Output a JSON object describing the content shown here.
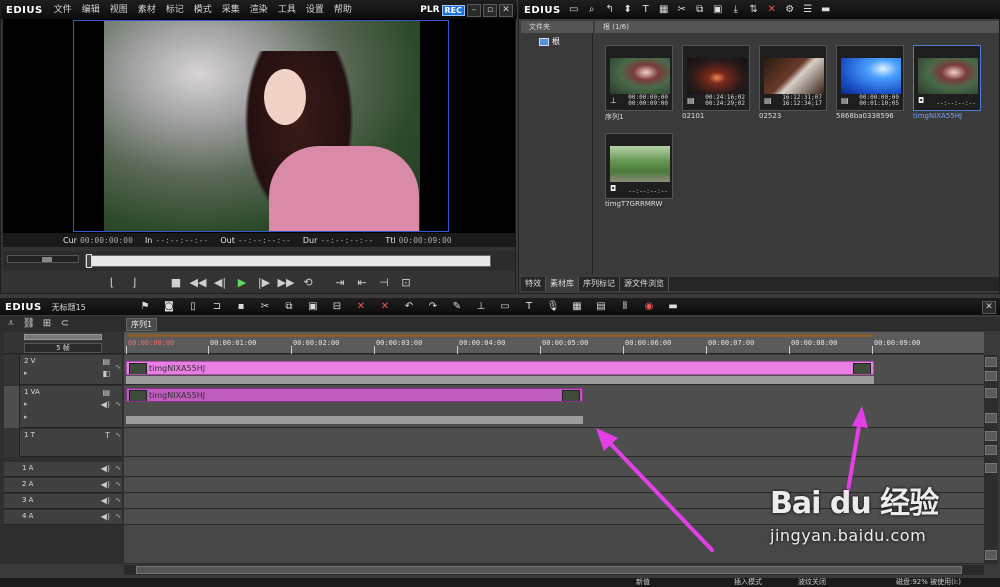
{
  "player": {
    "logo": "EDIUS",
    "menu": [
      "文件",
      "编辑",
      "视图",
      "素材",
      "标记",
      "模式",
      "采集",
      "渲染",
      "工具",
      "设置",
      "帮助"
    ],
    "plr": "PLR",
    "rec": "REC",
    "timecodes": {
      "cur_label": "Cur",
      "cur_value": "00:00:00:00",
      "in_label": "In",
      "in_value": "--:--:--:--",
      "out_label": "Out",
      "out_value": "--:--:--:--",
      "dur_label": "Dur",
      "dur_value": "--:--:--:--",
      "ttl_label": "Ttl",
      "ttl_value": "00:00:09:00"
    }
  },
  "bin": {
    "logo": "EDIUS",
    "folder_header": "文件夹",
    "folder_root": "根",
    "clips_header": "根 (1/6)",
    "clips": [
      {
        "name": "序列1",
        "tc1": "00:00:00;00",
        "tc2": "00:00:09:00",
        "type": "sequence",
        "thumb": "portrait",
        "selected": false
      },
      {
        "name": "02101",
        "tc1": "00:24:16;02",
        "tc2": "00:24:29;02",
        "type": "video",
        "thumb": "dark-red",
        "selected": false
      },
      {
        "name": "02523",
        "tc1": "16:12:31;07",
        "tc2": "16:12:34;17",
        "type": "video",
        "thumb": "hand",
        "selected": false
      },
      {
        "name": "5868ba0338596",
        "tc1": "00:00:00;00",
        "tc2": "00:01:10;05",
        "type": "video",
        "thumb": "blue",
        "selected": false
      },
      {
        "name": "timgNIXA55HJ",
        "tc1": "",
        "tc2": "--:--:--:--",
        "type": "still",
        "thumb": "portrait",
        "selected": true
      },
      {
        "name": "timgT7GRRMRW",
        "tc1": "",
        "tc2": "--:--:--:--",
        "type": "still",
        "thumb": "park",
        "selected": false
      }
    ],
    "tabs": [
      "特效",
      "素材库",
      "序列标记",
      "源文件浏览"
    ]
  },
  "timeline": {
    "logo": "EDIUS",
    "title": "无标题15",
    "sequence_tab": "序列1",
    "zoom_label": "5 帧",
    "ruler": [
      "00:00:00:00",
      "00:00:01:00",
      "00:00:02:00",
      "00:00:03:00",
      "00:00:04:00",
      "00:00:05:00",
      "00:00:06:00",
      "00:00:07:00",
      "00:00:08:00",
      "00:00:09:00"
    ],
    "tracks": [
      {
        "name": "2 V",
        "clip": "timgNIXA55HJ"
      },
      {
        "name": "1 VA",
        "clip": "timgNIXA55HJ"
      },
      {
        "name": "1 T"
      },
      {
        "name": "1 A"
      },
      {
        "name": "2 A"
      },
      {
        "name": "3 A"
      },
      {
        "name": "4 A"
      }
    ]
  },
  "status": {
    "s1": "新值",
    "s2": "插入模式",
    "s3": "波纹关闭",
    "s4": "磁盘:92% 被使用(I:)"
  },
  "watermark": {
    "brand": "Bai du 经验",
    "url": "jingyan.baidu.com"
  },
  "colors": {
    "pink_clip": "#e87fe2",
    "magenta_clip": "#bf5cbd",
    "arrow": "#e23fe6",
    "selected_blue": "#4e7ed7"
  }
}
